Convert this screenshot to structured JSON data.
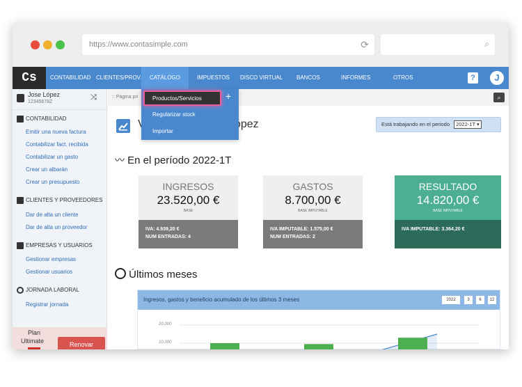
{
  "browser": {
    "url": "https://www.contasimple.com",
    "dots": [
      "#e74c3c",
      "#f1b12d",
      "#4cc24c"
    ]
  },
  "nav": {
    "logo": "Cs",
    "items": [
      {
        "label": "CONTABILIDAD"
      },
      {
        "label": "CLIENTES/PROV."
      },
      {
        "label": "CATÁLOGO"
      },
      {
        "label": "IMPUESTOS"
      },
      {
        "label": "DISCO VIRTUAL"
      },
      {
        "label": "BANCOS"
      },
      {
        "label": "INFORMES"
      },
      {
        "label": "OTROS"
      }
    ],
    "help": "?",
    "avatar": "J"
  },
  "dropdown": {
    "items": [
      {
        "label": "Productos/Servicios"
      },
      {
        "label": "Regularizar stock"
      },
      {
        "label": "Importar"
      }
    ],
    "plus": "+"
  },
  "sidebar": {
    "user_name": "Jose López",
    "user_id": "12345678Z",
    "sections": [
      {
        "title": "CONTABILIDAD",
        "links": [
          "Emitir una nueva factura",
          "Contabilizar fact. recibida",
          "Contabilizar un gasto",
          "Crear un albarán",
          "Crear un presupuesto"
        ]
      },
      {
        "title": "CLIENTES Y PROVEEDORES",
        "links": [
          "Dar de alta un cliente",
          "Dar de alta un proveedor"
        ]
      },
      {
        "title": "EMPRESAS Y USUARIOS",
        "links": [
          "Gestionar empresas",
          "Gestionar usuarios"
        ]
      },
      {
        "title": "JORNADA LABORAL",
        "links": [
          "Registrar jornada"
        ]
      }
    ],
    "plan_label": "Plan",
    "plan_name": "Ultimate",
    "renew": "Renovar"
  },
  "main": {
    "breadcrumb": ":: Página pri",
    "welcome_left": "V",
    "welcome_right": "se López",
    "period_label": "Está trabajando en el periodo",
    "period_value": "2022-1T",
    "period_heading": "En el período 2022-1T",
    "cards": [
      {
        "label": "INGRESOS",
        "value": "23.520,00 €",
        "sub": "BASE",
        "line1": "IVA: 4.939,20 €",
        "line2": "NUM ENTRADAS: 4"
      },
      {
        "label": "GASTOS",
        "value": "8.700,00 €",
        "sub": "BASE IMPUTABLE",
        "line1": "IVA IMPUTABLE: 1.575,00 €",
        "line2": "NUM ENTRADAS: 2"
      },
      {
        "label": "RESULTADO",
        "value": "14.820,00 €",
        "sub": "BASE IMPUTABLE",
        "line1": "IVA IMPUTABLE: 3.364,20 €",
        "line2": ""
      }
    ],
    "months_heading": "Últimos meses",
    "chart_title": "Ingresos, gastos y beneficio acumulado de los últimos 3 meses",
    "range_buttons": [
      "2022",
      "3",
      "6",
      "12"
    ]
  },
  "chart_data": {
    "type": "bar",
    "ylim": [
      0,
      20000
    ],
    "y_ticks": [
      "20,000",
      "10,000"
    ],
    "series": [
      {
        "type": "bar",
        "color": "#4caf50",
        "values": [
          10000,
          9500,
          13000
        ]
      },
      {
        "type": "line",
        "color": "#4a88ce",
        "values": [
          0,
          0,
          15000
        ]
      }
    ],
    "categories": [
      "",
      "",
      ""
    ]
  }
}
